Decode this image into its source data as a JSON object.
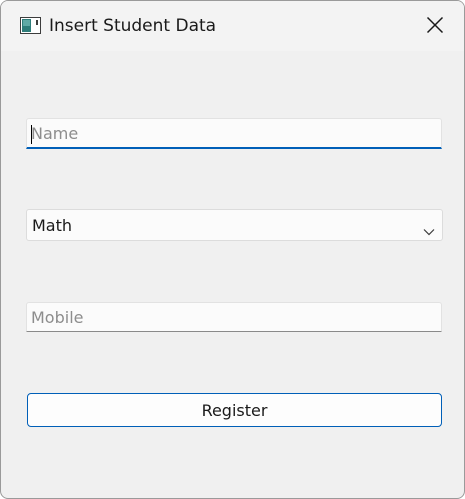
{
  "window": {
    "title": "Insert Student Data"
  },
  "icons": {
    "app": "app-window-icon",
    "close": "close-icon",
    "dropdown": "chevron-down-icon"
  },
  "form": {
    "name_field": {
      "value": "",
      "placeholder": "Name"
    },
    "subject_select": {
      "selected": "Math"
    },
    "mobile_field": {
      "value": "",
      "placeholder": "Mobile"
    },
    "register_label": "Register"
  },
  "colors": {
    "accent": "#005fb8",
    "window_background": "#f0f0f0",
    "field_background": "#fbfbfb"
  }
}
